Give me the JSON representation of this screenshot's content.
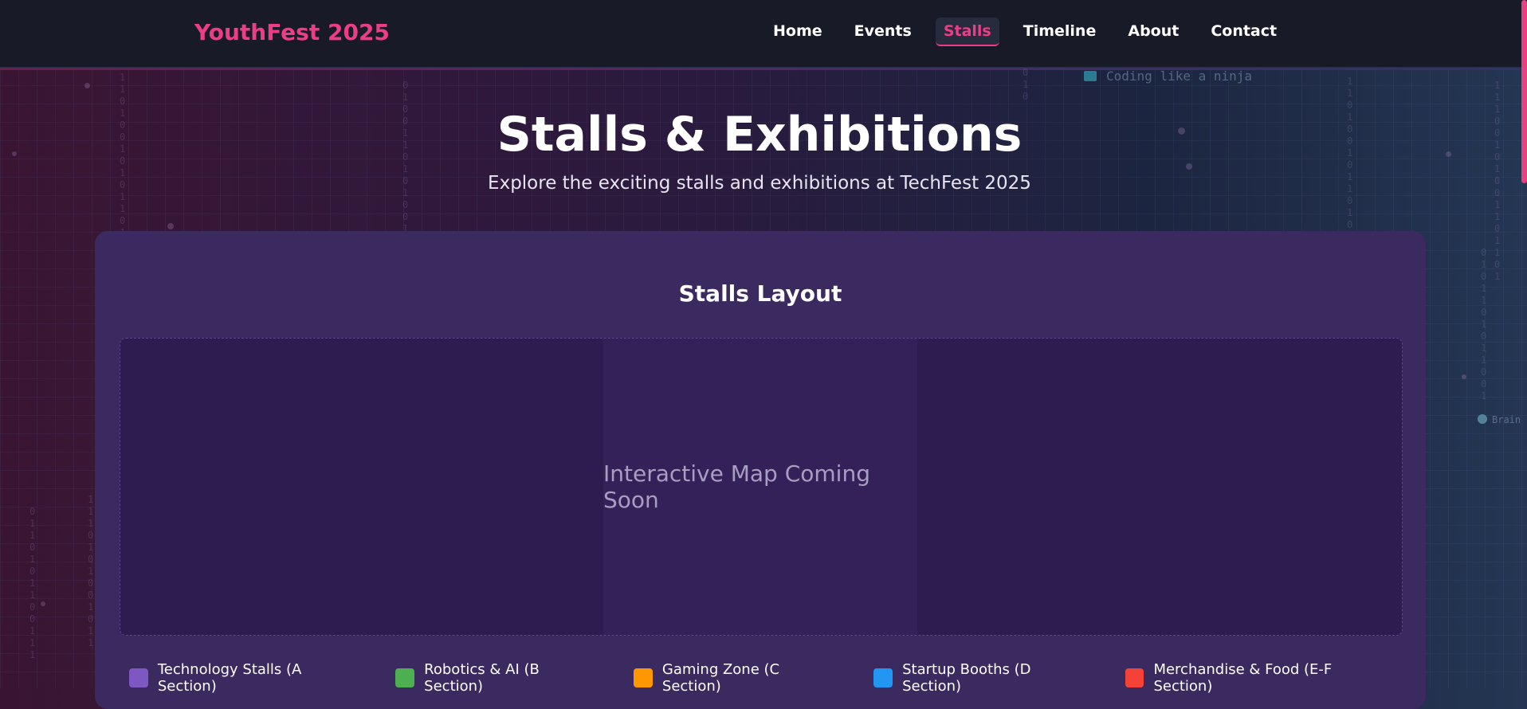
{
  "brand": {
    "name": "YouthFest 2025",
    "accent": "#ee3d87"
  },
  "nav": {
    "items": [
      {
        "label": "Home"
      },
      {
        "label": "Events"
      },
      {
        "label": "Stalls"
      },
      {
        "label": "Timeline"
      },
      {
        "label": "About"
      },
      {
        "label": "Contact"
      }
    ],
    "active": "Stalls"
  },
  "decor": {
    "tagline_icon": "laptop-icon",
    "tagline": "Coding like a ninja",
    "side_label_icon": "brain-icon",
    "side_label": "Brain"
  },
  "hero": {
    "title": "Stalls & Exhibitions",
    "subtitle": "Explore the exciting stalls and exhibitions at TechFest 2025"
  },
  "layout_section": {
    "title": "Stalls Layout",
    "map_placeholder": "Interactive Map Coming Soon"
  },
  "legend": [
    {
      "label": "Technology Stalls (A Section)",
      "color": "#7e57c2"
    },
    {
      "label": "Robotics & AI (B Section)",
      "color": "#4caf50"
    },
    {
      "label": "Gaming Zone (C Section)",
      "color": "#ff9800"
    },
    {
      "label": "Startup Booths (D Section)",
      "color": "#2196f3"
    },
    {
      "label": "Merchandise & Food (E-F Section)",
      "color": "#f44336"
    }
  ]
}
